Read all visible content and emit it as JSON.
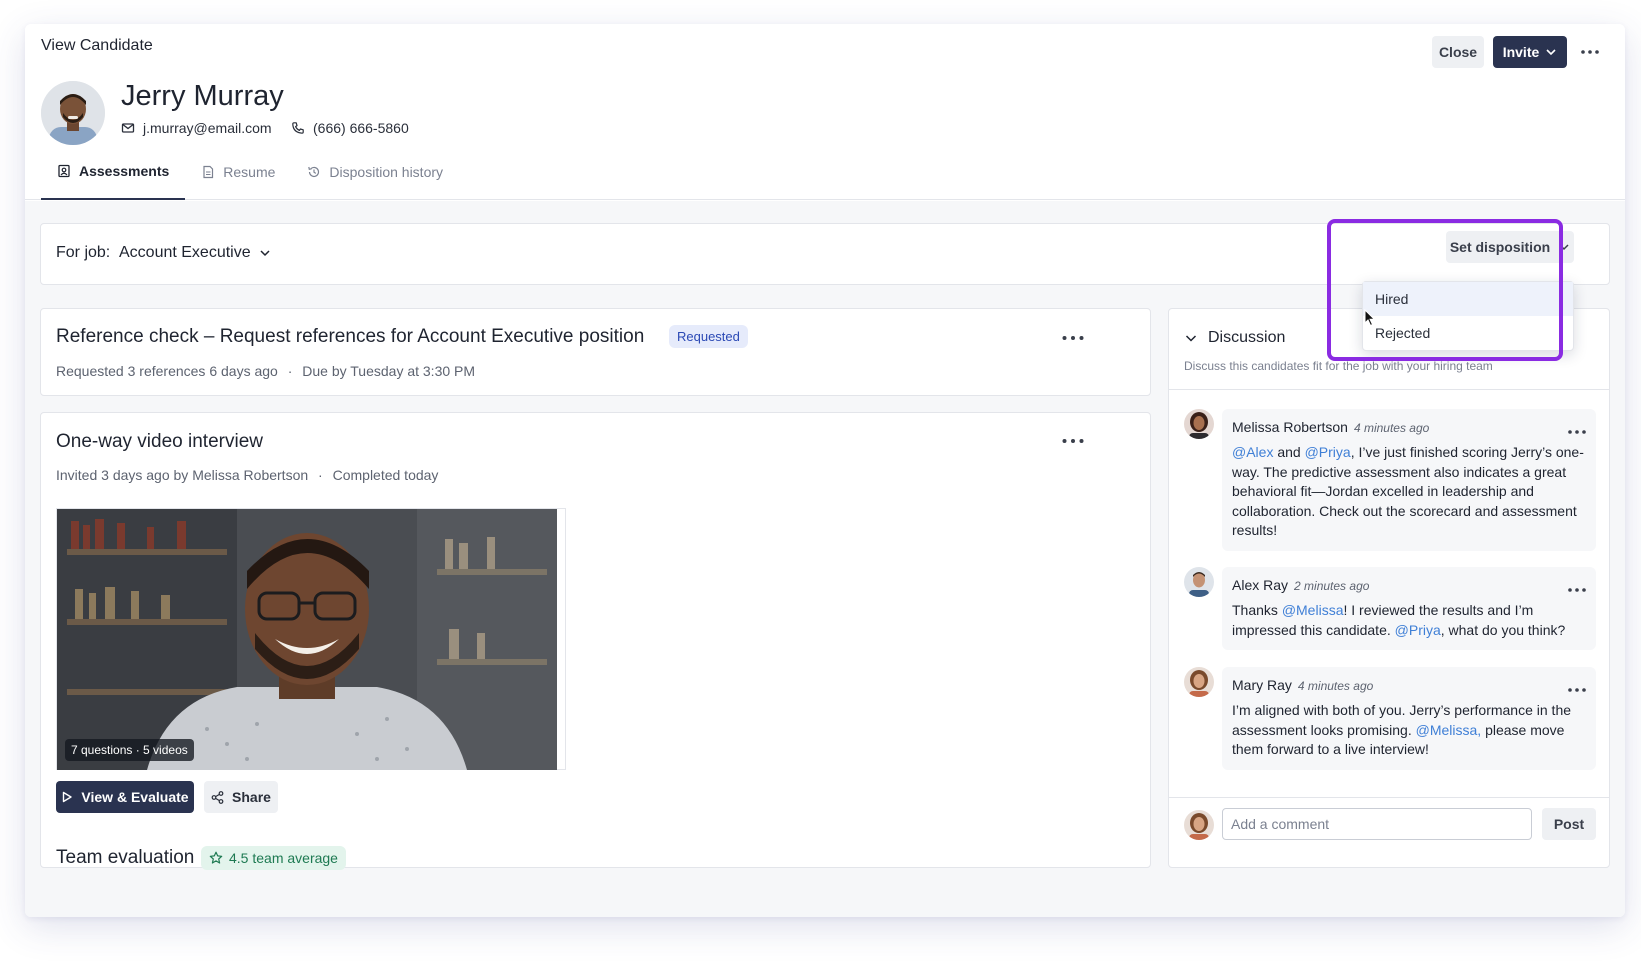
{
  "header": {
    "view_title": "View Candidate",
    "candidate_name": "Jerry Murray",
    "email": "j.murray@email.com",
    "phone": "(666) 666-5860",
    "close_label": "Close",
    "invite_label": "Invite"
  },
  "tabs": [
    {
      "label": "Assessments",
      "icon": "assessment-icon",
      "active": true
    },
    {
      "label": "Resume",
      "icon": "document-icon",
      "active": false
    },
    {
      "label": "Disposition history",
      "icon": "history-icon",
      "active": false
    }
  ],
  "job": {
    "label": "For job:",
    "value": "Account Executive",
    "set_disposition_label": "Set disposition",
    "disposition_options": [
      "Hired",
      "Rejected"
    ],
    "hovered_option": "Hired"
  },
  "reference_check": {
    "title": "Reference check – Request references for Account Executive position",
    "status": "Requested",
    "meta_1": "Requested 3 references 6 days ago",
    "separator": "·",
    "meta_2": "Due by Tuesday at 3:30 PM"
  },
  "video_interview": {
    "title": "One-way video interview",
    "meta_1": "Invited 3 days ago by Melissa Robertson",
    "separator": "·",
    "meta_2": "Completed today",
    "video_badge": "7 questions · 5 videos",
    "view_evaluate_label": "View & Evaluate",
    "share_label": "Share",
    "team_eval_title": "Team evaluation",
    "team_average": "4.5 team average"
  },
  "discussion": {
    "title": "Discussion",
    "subtitle": "Discuss this candidates fit for the job with your hiring team",
    "comments": [
      {
        "author": "Melissa Robertson",
        "time": "4 minutes ago",
        "m1": "@Alex",
        "t1": " and ",
        "m2": "@Priya",
        "t2": ", I’ve just finished scoring Jerry’s one-way. The predictive assessment also indicates a great behavioral fit—Jordan excelled in leadership and collaboration. Check out the scorecard and assessment results!"
      },
      {
        "author": "Alex Ray",
        "time": "2 minutes ago",
        "t0": "Thanks ",
        "m1": "@Melissa",
        "t1": "! I reviewed the results and I’m impressed this candidate. ",
        "m2": "@Priya",
        "t2": ", what do you think?"
      },
      {
        "author": "Mary Ray",
        "time": "4 minutes ago",
        "t0": "I’m aligned with both of you. Jerry’s performance in the assessment looks promising. ",
        "m1": "@Melissa,",
        "t1": " please move them forward to a live interview!"
      }
    ],
    "comment_placeholder": "Add a comment",
    "post_label": "Post"
  },
  "colors": {
    "primary": "#2a3350",
    "mention": "#3f7fd6",
    "highlight": "#8a2be2",
    "requested_badge_bg": "#e6ebfb",
    "average_badge_bg": "#e3f4ec"
  }
}
